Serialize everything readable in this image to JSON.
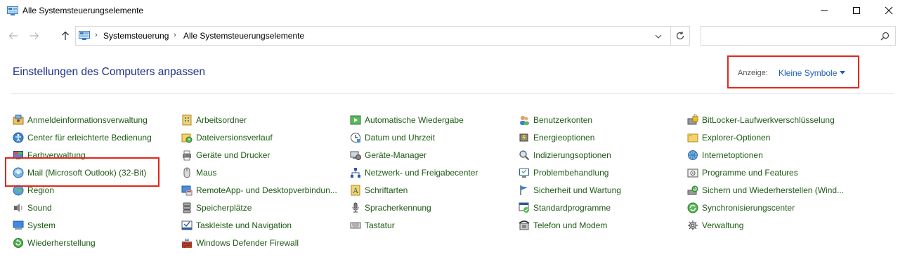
{
  "window": {
    "title": "Alle Systemsteuerungselemente"
  },
  "address": {
    "crumb1": "Systemsteuerung",
    "crumb2": "Alle Systemsteuerungselemente",
    "separator": "›"
  },
  "search": {
    "placeholder": ""
  },
  "header": {
    "title": "Einstellungen des Computers anpassen",
    "view_label": "Anzeige:",
    "view_value": "Kleine Symbole"
  },
  "items": {
    "col1": [
      {
        "label": "Anmeldeinformationsverwaltung",
        "icon": "credentials-icon"
      },
      {
        "label": "Center für erleichterte Bedienung",
        "icon": "ease-of-access-icon"
      },
      {
        "label": "Farbverwaltung",
        "icon": "color-management-icon"
      },
      {
        "label": "Mail (Microsoft Outlook) (32-Bit)",
        "icon": "mail-icon"
      },
      {
        "label": "Region",
        "icon": "region-icon"
      },
      {
        "label": "Sound",
        "icon": "sound-icon"
      },
      {
        "label": "System",
        "icon": "system-icon"
      },
      {
        "label": "Wiederherstellung",
        "icon": "recovery-icon"
      }
    ],
    "col2": [
      {
        "label": "Arbeitsordner",
        "icon": "work-folders-icon"
      },
      {
        "label": "Dateiversionsverlauf",
        "icon": "file-history-icon"
      },
      {
        "label": "Geräte und Drucker",
        "icon": "devices-printers-icon"
      },
      {
        "label": "Maus",
        "icon": "mouse-icon"
      },
      {
        "label": "RemoteApp- und Desktopverbindun...",
        "icon": "remoteapp-icon"
      },
      {
        "label": "Speicherplätze",
        "icon": "storage-spaces-icon"
      },
      {
        "label": "Taskleiste und Navigation",
        "icon": "taskbar-icon"
      },
      {
        "label": "Windows Defender Firewall",
        "icon": "firewall-icon"
      }
    ],
    "col3": [
      {
        "label": "Automatische Wiedergabe",
        "icon": "autoplay-icon"
      },
      {
        "label": "Datum und Uhrzeit",
        "icon": "date-time-icon"
      },
      {
        "label": "Geräte-Manager",
        "icon": "device-manager-icon"
      },
      {
        "label": "Netzwerk- und Freigabecenter",
        "icon": "network-icon"
      },
      {
        "label": "Schriftarten",
        "icon": "fonts-icon"
      },
      {
        "label": "Spracherkennung",
        "icon": "speech-icon"
      },
      {
        "label": "Tastatur",
        "icon": "keyboard-icon"
      }
    ],
    "col4": [
      {
        "label": "Benutzerkonten",
        "icon": "user-accounts-icon"
      },
      {
        "label": "Energieoptionen",
        "icon": "power-options-icon"
      },
      {
        "label": "Indizierungsoptionen",
        "icon": "indexing-icon"
      },
      {
        "label": "Problembehandlung",
        "icon": "troubleshooting-icon"
      },
      {
        "label": "Sicherheit und Wartung",
        "icon": "security-maintenance-icon"
      },
      {
        "label": "Standardprogramme",
        "icon": "default-programs-icon"
      },
      {
        "label": "Telefon und Modem",
        "icon": "phone-modem-icon"
      }
    ],
    "col5": [
      {
        "label": "BitLocker-Laufwerkverschlüsselung",
        "icon": "bitlocker-icon"
      },
      {
        "label": "Explorer-Optionen",
        "icon": "explorer-options-icon"
      },
      {
        "label": "Internetoptionen",
        "icon": "internet-options-icon"
      },
      {
        "label": "Programme und Features",
        "icon": "programs-features-icon"
      },
      {
        "label": "Sichern und Wiederherstellen (Wind...",
        "icon": "backup-restore-icon"
      },
      {
        "label": "Synchronisierungscenter",
        "icon": "sync-center-icon"
      },
      {
        "label": "Verwaltung",
        "icon": "admin-tools-icon"
      }
    ]
  },
  "colors": {
    "link_green": "#1d5a14",
    "title_blue": "#1e3287",
    "accent_blue": "#1f5dbd",
    "highlight_red": "#e3261b"
  }
}
